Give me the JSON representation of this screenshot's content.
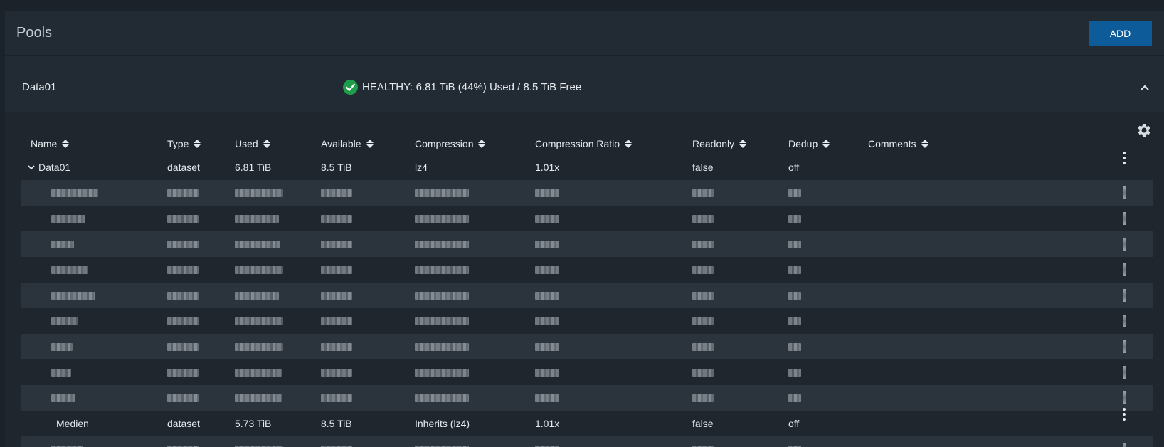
{
  "page": {
    "title": "Pools",
    "add_label": "ADD"
  },
  "pool": {
    "name": "Data01",
    "status": "HEALTHY: 6.81 TiB (44%) Used / 8.5 TiB Free"
  },
  "columns": [
    "Name",
    "Type",
    "Used",
    "Available",
    "Compression",
    "Compression Ratio",
    "Readonly",
    "Dedup",
    "Comments"
  ],
  "root_row": {
    "name": "Data01",
    "type": "dataset",
    "used": "6.81 TiB",
    "available": "8.5 TiB",
    "compression": "lz4",
    "ratio": "1.01x",
    "readonly": "false",
    "dedup": "off"
  },
  "medien_row": {
    "name": "Medien",
    "type": "dataset",
    "used": "5.73 TiB",
    "available": "8.5 TiB",
    "compression": "Inherits (lz4)",
    "ratio": "1.01x",
    "readonly": "false",
    "dedup": "off"
  },
  "colors": {
    "accent": "#0d5b98",
    "healthy": "#1e9e4a",
    "background": "#222a33"
  },
  "icons": [
    "check-circle-icon",
    "chevron-up-icon",
    "gear-icon",
    "chevron-down-icon",
    "more-vert-icon",
    "sort-icon"
  ]
}
